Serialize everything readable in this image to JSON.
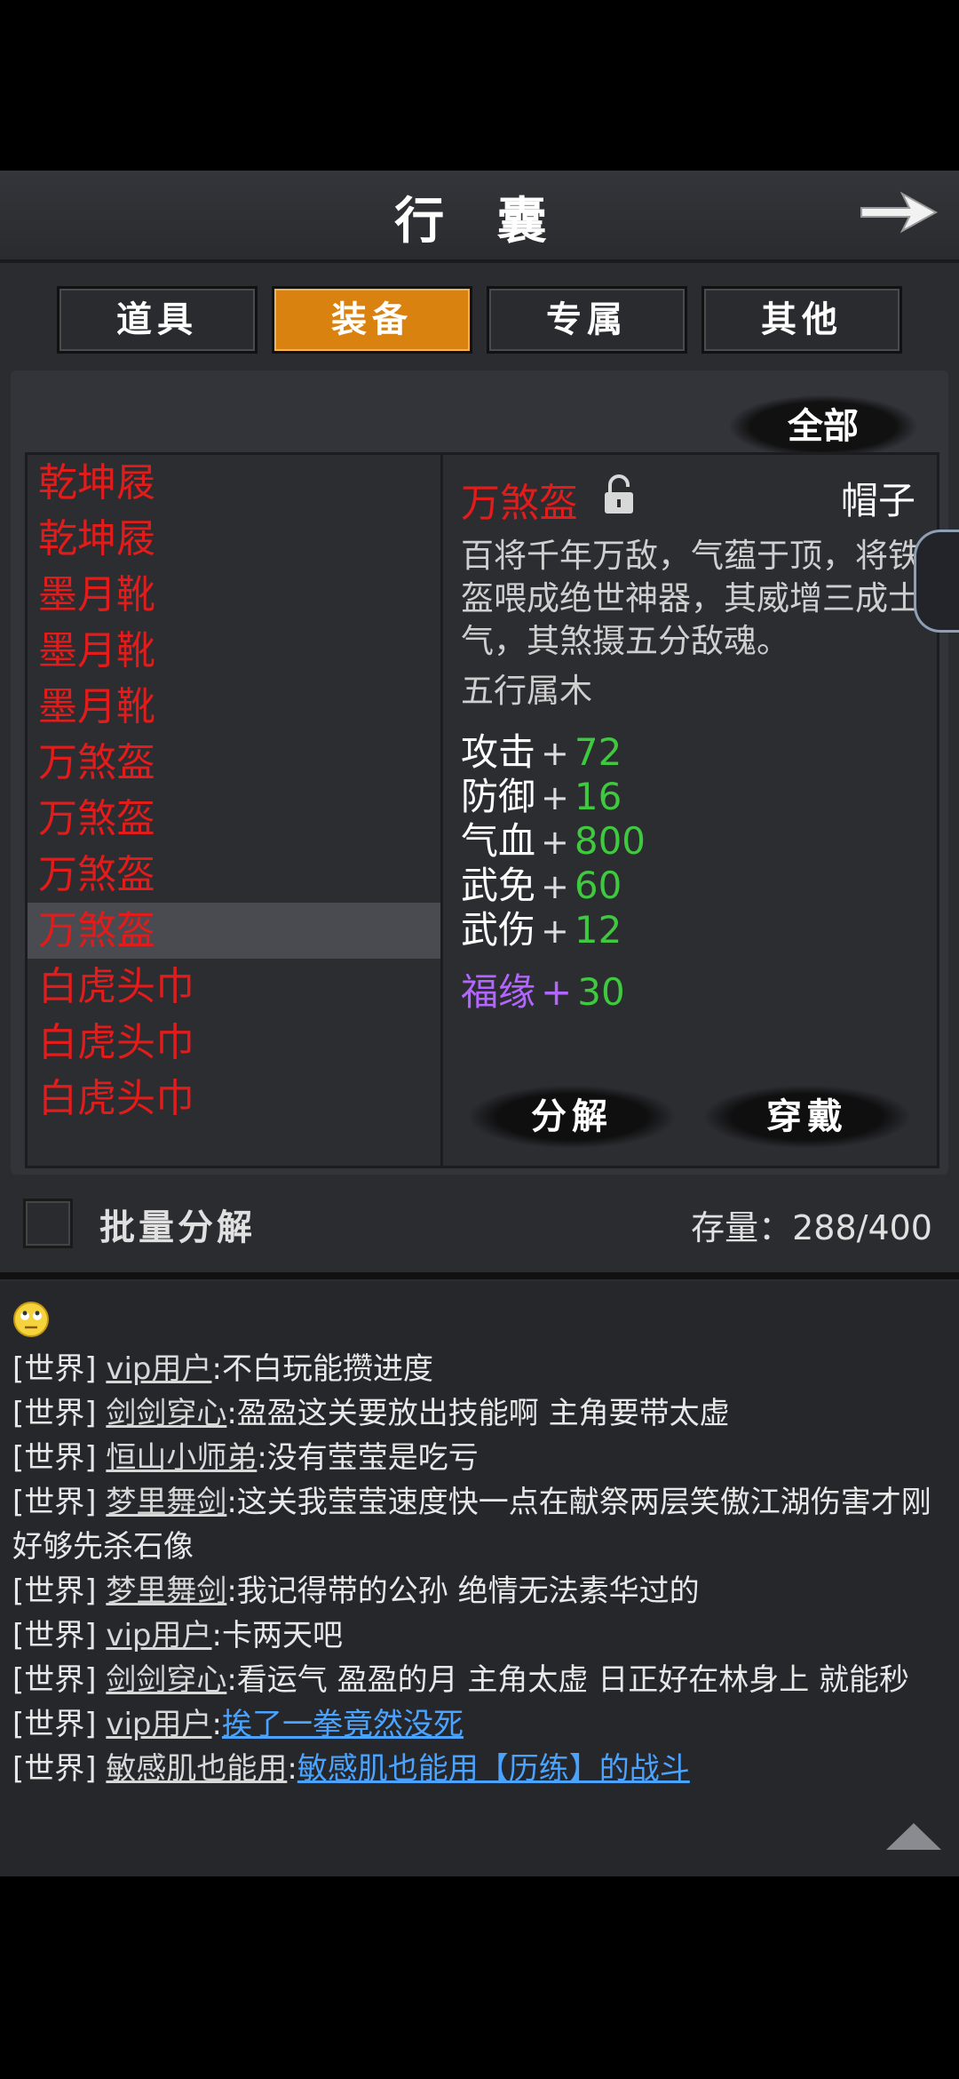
{
  "header": {
    "title": "行 囊"
  },
  "tabs": [
    {
      "label": "道具",
      "active": false
    },
    {
      "label": "装备",
      "active": true
    },
    {
      "label": "专属",
      "active": false
    },
    {
      "label": "其他",
      "active": false
    }
  ],
  "filter": {
    "label": "全部"
  },
  "inventory_list": {
    "items": [
      "乾坤屐",
      "乾坤屐",
      "墨月靴",
      "墨月靴",
      "墨月靴",
      "万煞盔",
      "万煞盔",
      "万煞盔",
      "万煞盔",
      "白虎头巾",
      "白虎头巾",
      "白虎头巾"
    ],
    "selected_index": 8
  },
  "detail": {
    "name": "万煞盔",
    "slot": "帽子",
    "description": "百将千年万敌，气蕴于顶，将铁盔喂成绝世神器，其威增三成士气，其煞摄五分敌魂。",
    "element": "五行属木",
    "stats": [
      {
        "name": "攻击",
        "plus": "+",
        "value": "72"
      },
      {
        "name": "防御",
        "plus": "+",
        "value": "16"
      },
      {
        "name": "气血",
        "plus": "+",
        "value": "800"
      },
      {
        "name": "武免",
        "plus": "+",
        "value": "60"
      },
      {
        "name": "武伤",
        "plus": "+",
        "value": "12"
      }
    ],
    "bonus": {
      "name": "福缘",
      "plus": "+",
      "value": "30"
    },
    "dismantle_label": "分解",
    "equip_label": "穿戴"
  },
  "bottom": {
    "batch_label": "批量分解",
    "capacity_label": "存量：",
    "capacity_value": "288/400"
  },
  "chat": {
    "lines": [
      {
        "channel": "[世界]",
        "user": "vip用户",
        "text": ":不白玩能攒进度",
        "link": ""
      },
      {
        "channel": "[世界]",
        "user": "剑剑穿心",
        "text": ":盈盈这关要放出技能啊  主角要带太虚",
        "link": ""
      },
      {
        "channel": "[世界]",
        "user": "恒山小师弟",
        "text": ":没有莹莹是吃亏",
        "link": ""
      },
      {
        "channel": "[世界]",
        "user": "梦里舞剑",
        "text": ":这关我莹莹速度快一点在献祭两层笑傲江湖伤害才刚好够先杀石像",
        "link": ""
      },
      {
        "channel": "[世界]",
        "user": "梦里舞剑",
        "text": ":我记得带的公孙  绝情无法素华过的",
        "link": ""
      },
      {
        "channel": "[世界]",
        "user": "vip用户",
        "text": ":卡两天吧",
        "link": ""
      },
      {
        "channel": "[世界]",
        "user": "剑剑穿心",
        "text": ":看运气  盈盈的月  主角太虚  日正好在林身上  就能秒",
        "link": ""
      },
      {
        "channel": "[世界]",
        "user": "vip用户",
        "text": ":",
        "link": "挨了一拳竟然没死"
      },
      {
        "channel": "[世界]",
        "user": "敏感肌也能用",
        "text": ":",
        "link": "敏感肌也能用【历练】的战斗"
      }
    ]
  },
  "icons": {
    "back": "arrow-right-icon",
    "lock": "lock-icon",
    "emoji": "eyeroll-emoji-icon",
    "scroll_up": "triangle-up-icon"
  },
  "colors": {
    "accent_tab": "#d9820f",
    "item_red": "#e21b1b",
    "stat_green": "#3ec93e",
    "bonus_purple": "#b266ff",
    "link_blue": "#4aa3ff"
  }
}
